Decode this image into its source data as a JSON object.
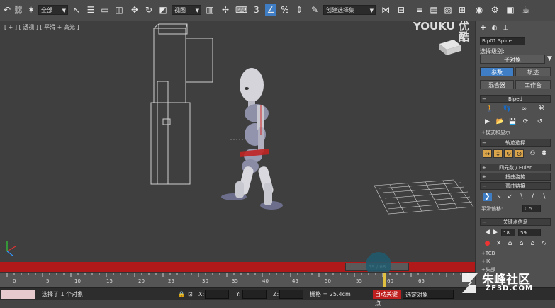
{
  "toolbar": {
    "selection_filter": "全部",
    "ref_coord": "视图",
    "named_selection": "创建选择集",
    "snap_angle": "3"
  },
  "viewport": {
    "label": "[ + ] [ 透视 ] [ 平滑 + 高光 ]",
    "watermark": "YOUKU 优酷"
  },
  "timeline": {
    "slider": "59 / 68",
    "ticks": [
      "0",
      "5",
      "10",
      "15",
      "20",
      "25",
      "30",
      "35",
      "40",
      "45",
      "50",
      "55",
      "60",
      "65"
    ]
  },
  "status": {
    "selected": "选择了 1 个对象",
    "x_label": "X:",
    "y_label": "Y:",
    "z_label": "Z:",
    "grid": "栅格 = 25.4cm",
    "auto_key": "自动关键点",
    "set_key_filter": "选定对象"
  },
  "panel": {
    "object_name": "Bip01 Spine",
    "selection_level": "选择级别:",
    "sub_object": "子对象",
    "tabs": [
      "参数",
      "轨迹"
    ],
    "sub_tabs": [
      "混合器",
      "工作台"
    ],
    "rollout_biped": "Biped",
    "mode_display": "+模式和显示",
    "rollout_track": "轨迹选择",
    "rollout_quat": "四元数 / Euler",
    "rollout_twist": "扭曲姿势",
    "rollout_bend": "弯曲链接",
    "smooth_bias": "平滑偏移:",
    "smooth_bias_value": "0.5",
    "rollout_keyinfo": "关键点信息",
    "key_number": "18",
    "key_time": "59",
    "tcb": "+TCB",
    "ik": "+IK",
    "head": "+头部"
  },
  "branding": {
    "site": "朱峰社区",
    "url": "ZF3D.COM"
  }
}
